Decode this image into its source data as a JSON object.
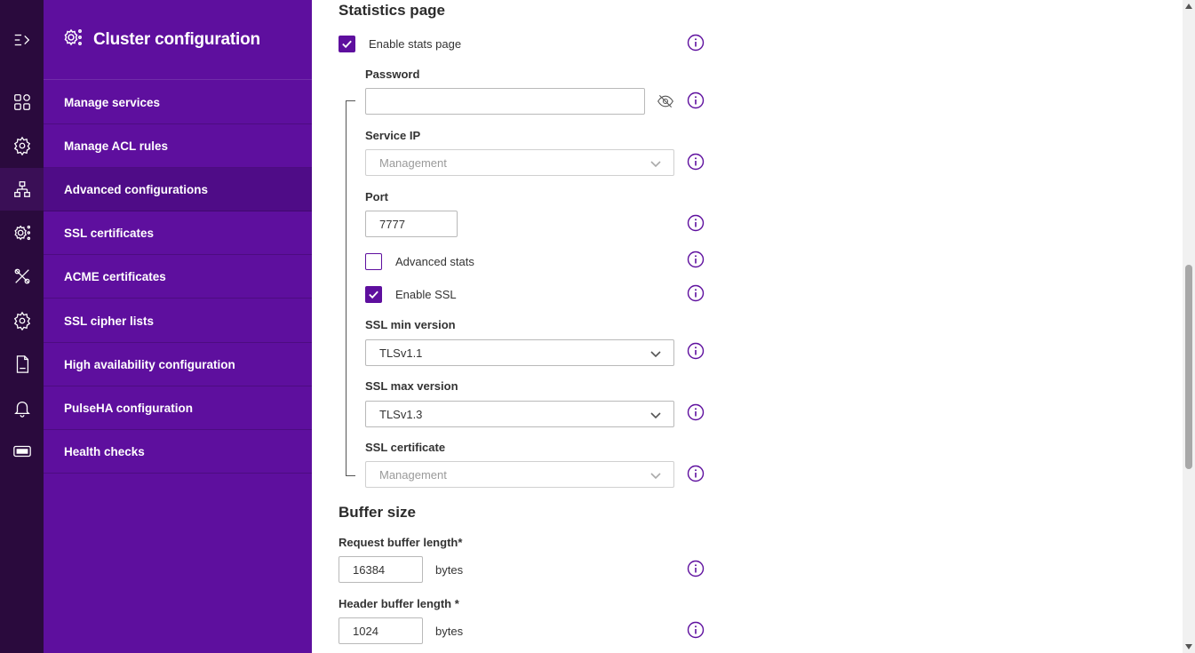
{
  "sidebar": {
    "title": "Cluster configuration",
    "items": [
      {
        "label": "Manage services"
      },
      {
        "label": "Manage ACL rules"
      },
      {
        "label": "Advanced configurations"
      },
      {
        "label": "SSL certificates"
      },
      {
        "label": "ACME certificates"
      },
      {
        "label": "SSL cipher lists"
      },
      {
        "label": "High availability configuration"
      },
      {
        "label": "PulseHA configuration"
      },
      {
        "label": "Health checks"
      }
    ],
    "active_item": "Advanced configurations"
  },
  "statistics": {
    "heading": "Statistics page",
    "enable_stats": {
      "label": "Enable stats page",
      "checked": true
    },
    "password": {
      "label": "Password",
      "value": ""
    },
    "service_ip": {
      "label": "Service IP",
      "value": "Management"
    },
    "port": {
      "label": "Port",
      "value": "7777"
    },
    "advanced_stats": {
      "label": "Advanced stats",
      "checked": false
    },
    "enable_ssl": {
      "label": "Enable SSL",
      "checked": true
    },
    "ssl_min_version": {
      "label": "SSL min version",
      "value": "TLSv1.1"
    },
    "ssl_max_version": {
      "label": "SSL max version",
      "value": "TLSv1.3"
    },
    "ssl_certificate": {
      "label": "SSL certificate",
      "value": "Management"
    }
  },
  "buffer": {
    "heading": "Buffer size",
    "request_buffer": {
      "label": "Request buffer length*",
      "value": "16384",
      "unit": "bytes"
    },
    "header_buffer": {
      "label": "Header buffer length *",
      "value": "1024",
      "unit": "bytes"
    }
  },
  "colors": {
    "rail": "#2a0a3d",
    "sidebar": "#5e0f9e",
    "sidebar_active": "#4f0c87",
    "accent": "#5e0f9e"
  }
}
